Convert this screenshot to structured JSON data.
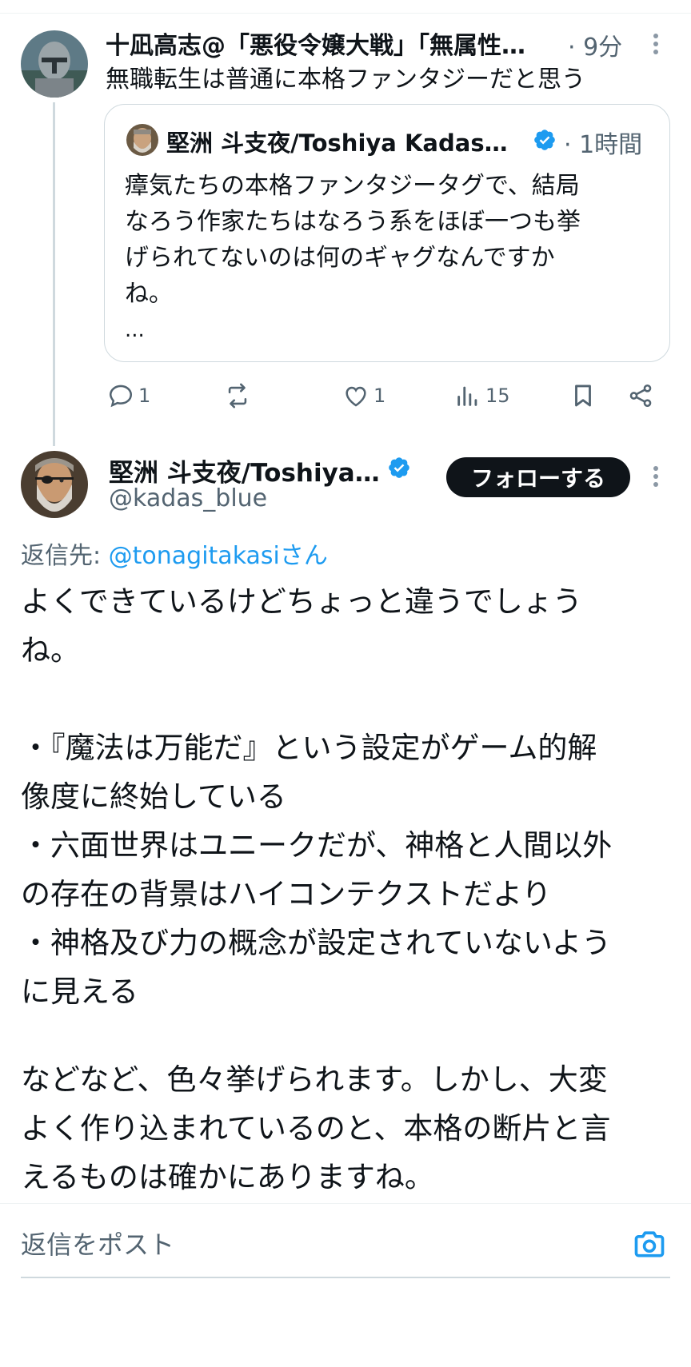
{
  "parent_tweet": {
    "author_name": "十凪高志@「悪役令嬢大戦」「無属性…",
    "time": "· 9分",
    "text": "無職転生は普通に本格ファンタジーだと思う",
    "quoted": {
      "author_name": "堅洲 斗支夜/Toshiya Kadas…",
      "time": "· 1時間",
      "lines": [
        "瘴気たちの本格ファンタジータグで、結局",
        "なろう作家たちはなろう系をほぼ一つも挙",
        "げられてないのは何のギャグなんですか",
        "ね。"
      ],
      "more": "..."
    },
    "actions": {
      "replies": "1",
      "retweets": "",
      "likes": "1",
      "views": "15"
    }
  },
  "main_tweet": {
    "author_name": "堅洲 斗支夜/Toshiya…",
    "handle": "@kadas_blue",
    "follow_label": "フォローする",
    "reply_prefix": "返信先: ",
    "reply_mention": "@tonagitakasiさん",
    "lines": [
      "よくできているけどちょっと違うでしょう",
      "ね。",
      "",
      "・『魔法は万能だ』という設定がゲーム的解",
      "像度に終始している",
      "・六面世界はユニークだが、神格と人間以外",
      "の存在の背景はハイコンテクストだより",
      "・神格及び力の概念が設定されていないよう",
      "に見える",
      "",
      "などなど、色々挙げられます。しかし、大変",
      "よく作り込まれているのと、本格の断片と言",
      "えるものは確かにありますね。"
    ]
  },
  "composer": {
    "placeholder": "返信をポスト"
  },
  "colors": {
    "accent": "#1d9bf0",
    "text": "#0f1419",
    "secondary": "#536471",
    "border": "#cfd9de"
  },
  "icons": [
    "more-icon",
    "verified-badge-icon",
    "reply-icon",
    "retweet-icon",
    "like-icon",
    "views-icon",
    "bookmark-icon",
    "share-icon",
    "camera-icon"
  ]
}
